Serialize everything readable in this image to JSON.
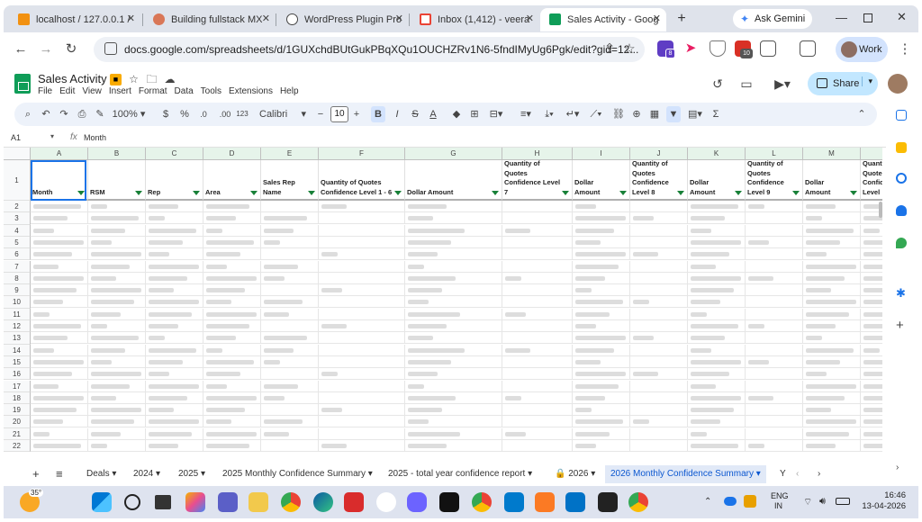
{
  "browser": {
    "tabs": [
      {
        "label": "localhost / 127.0.0.1 /",
        "icon": "phpmyadmin-icon",
        "color": "#f29111"
      },
      {
        "label": "Building fullstack MX",
        "icon": "claude-icon",
        "color": "#d97757"
      },
      {
        "label": "WordPress Plugin Pro",
        "icon": "openai-icon",
        "color": "#444444"
      },
      {
        "label": "Inbox (1,412) - veera",
        "icon": "gmail-icon",
        "color": "#ea4335"
      },
      {
        "label": "Sales Activity - Goog",
        "icon": "sheets-icon",
        "color": "#0f9d58",
        "active": true
      }
    ],
    "new_tab": "+",
    "gemini": "Ask Gemini",
    "url": "docs.google.com/spreadsheets/d/1GUXchdBUtGukPBqXQu1OUCHZRv1N6-5fndIMyUg6Pgk/edit?gid=12...",
    "profile": "Work",
    "ext_badges": [
      "8",
      "10"
    ]
  },
  "sheet": {
    "title": "Sales Activity",
    "menu": [
      "File",
      "Edit",
      "View",
      "Insert",
      "Format",
      "Data",
      "Tools",
      "Extensions",
      "Help"
    ],
    "share": "Share"
  },
  "toolbar": {
    "zoom": "100%",
    "currency": "$",
    "percent": "%",
    "dec_dec": ".0",
    "dec_inc": ".00",
    "format_123": "123",
    "font": "Calibri",
    "font_size": "10",
    "bold": "B",
    "italic": "I",
    "strike": "S",
    "text_color": "A",
    "functions": "Σ"
  },
  "formula_bar": {
    "cell_ref": "A1",
    "fx": "fx",
    "value": "Month"
  },
  "grid": {
    "columns": [
      "A",
      "B",
      "C",
      "D",
      "E",
      "F",
      "G",
      "H",
      "I",
      "J",
      "K",
      "L",
      "M",
      "N"
    ],
    "headers": [
      "Month",
      "RSM",
      "Rep",
      "Area",
      "Sales Rep Name",
      "Quantity of Quotes Confidence Level 1 - 6",
      "Dollar Amount",
      "Quantity of Quotes Confidence Level 7",
      "Dollar Amount",
      "Quantity of Quotes Confidence Level 8",
      "Dollar Amount",
      "Quantity of Quotes Confidence Level 9",
      "Dollar Amount",
      "Quantity of Quotes Confidence Level"
    ],
    "rows": [
      "1",
      "2",
      "3",
      "4",
      "5",
      "6",
      "7",
      "8",
      "9",
      "10",
      "11",
      "12",
      "13",
      "14",
      "15",
      "16",
      "17",
      "18",
      "19",
      "20",
      "21",
      "22"
    ]
  },
  "sheet_tabs": {
    "add": "+",
    "list": "≡",
    "tabs": [
      {
        "label": "Deals",
        "locked": false
      },
      {
        "label": "2024",
        "locked": false
      },
      {
        "label": "2025",
        "locked": false
      },
      {
        "label": "2025 Monthly Confidence Summary",
        "locked": false
      },
      {
        "label": "2025 - total year confidence report",
        "locked": false
      },
      {
        "label": "2026",
        "locked": true
      },
      {
        "label": "2026 Monthly Confidence Summary",
        "locked": false,
        "active": true
      },
      {
        "label": "Y",
        "locked": false
      }
    ]
  },
  "taskbar": {
    "weather": "35°",
    "lang_top": "ENG",
    "lang_bottom": "IN",
    "time": "16:46",
    "date": "13-04-2026"
  }
}
